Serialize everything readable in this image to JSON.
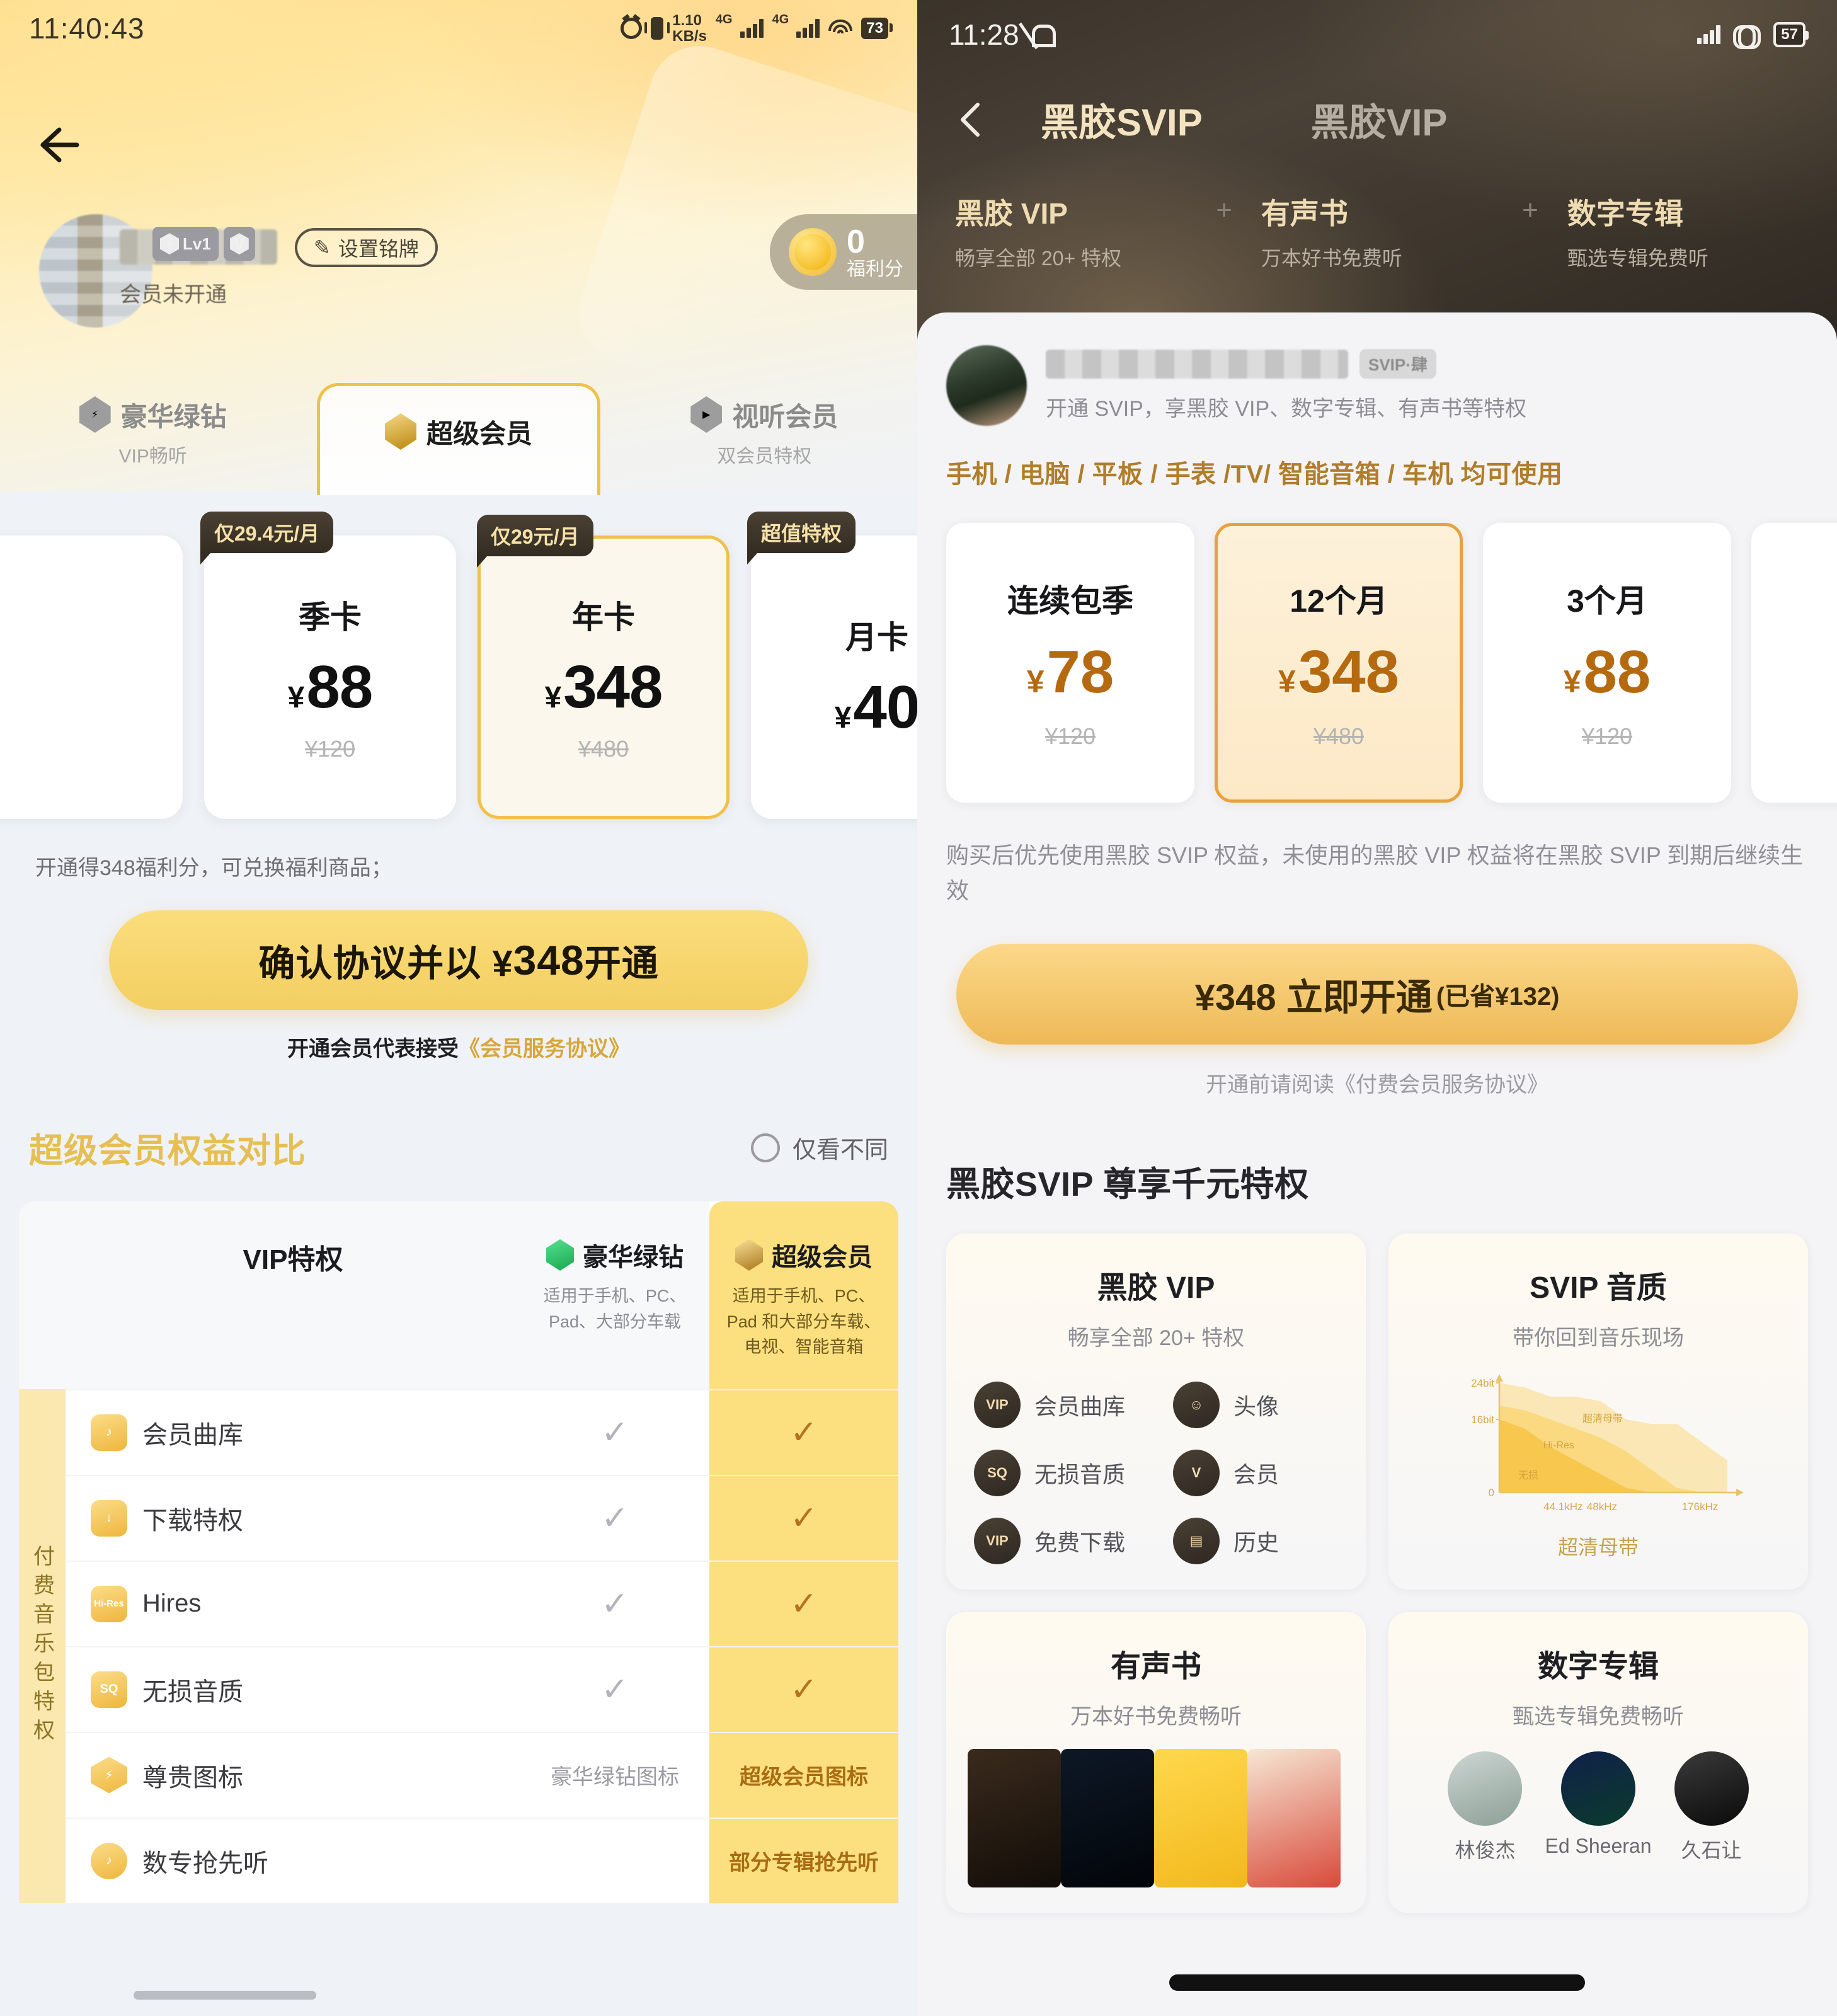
{
  "left": {
    "status": {
      "time": "11:40:43",
      "netspeed_value": "1.10",
      "netspeed_unit": "KB/s",
      "net_type_1": "4G",
      "net_type_2": "4G",
      "battery": "73"
    },
    "back_icon": "back-arrow-icon",
    "profile": {
      "level_badge": "Lv1",
      "set_plate_label": "设置铭牌",
      "membership_status": "会员未开通",
      "score_value": "0",
      "score_label": "福利分"
    },
    "tabs": [
      {
        "name": "豪华绿钻",
        "sub": "VIP畅听",
        "active": false
      },
      {
        "name": "超级会员",
        "sub": "",
        "active": true
      },
      {
        "name": "视听会员",
        "sub": "双会员特权",
        "active": false
      }
    ],
    "plans": [
      {
        "tag": "仅29.4元/月",
        "name": "季卡",
        "currency": "¥",
        "price": "88",
        "old": "¥120",
        "selected": false
      },
      {
        "tag": "仅29元/月",
        "name": "年卡",
        "currency": "¥",
        "price": "348",
        "old": "¥480",
        "selected": true
      },
      {
        "tag": "超值特权",
        "name": "月卡",
        "currency": "¥",
        "price": "40",
        "old": "",
        "selected": false
      }
    ],
    "benefit_note": "开通得348福利分，可兑换福利商品；",
    "cta": {
      "prefix": "确认协议并以 ¥",
      "amount": "348",
      "suffix": " 开通"
    },
    "agreement": {
      "text": "开通会员代表接受",
      "link": "《会员服务协议》"
    },
    "compare": {
      "title": "超级会员权益对比",
      "filter_label": "仅看不同",
      "side_label": "付费音乐包特权",
      "col_feature": "VIP特权",
      "col_green": {
        "brand": "豪华绿钻",
        "sub": "适用于手机、PC、Pad、大部分车载"
      },
      "col_super": {
        "brand": "超级会员",
        "sub": "适用于手机、PC、Pad 和大部分车载、电视、智能音箱"
      },
      "rows": [
        {
          "icon": "music-library-icon",
          "icon_text": "♪",
          "label": "会员曲库",
          "green": "✓",
          "super": "✓",
          "green_type": "check",
          "super_type": "check"
        },
        {
          "icon": "download-icon",
          "icon_text": "↓",
          "label": "下载特权",
          "green": "✓",
          "super": "✓",
          "green_type": "check",
          "super_type": "check"
        },
        {
          "icon": "hires-icon",
          "icon_text": "Hi-Res",
          "label": "Hires",
          "green": "✓",
          "super": "✓",
          "green_type": "check",
          "super_type": "check"
        },
        {
          "icon": "sq-icon",
          "icon_text": "SQ",
          "label": "无损音质",
          "green": "✓",
          "super": "✓",
          "green_type": "check",
          "super_type": "check"
        },
        {
          "icon": "vip-emblem-icon",
          "icon_text": "⚡",
          "label": "尊贵图标",
          "green": "豪华绿钻图标",
          "super": "超级会员图标",
          "green_type": "text",
          "super_type": "text"
        },
        {
          "icon": "album-preorder-icon",
          "icon_text": "♪",
          "label": "数专抢先听",
          "green": "",
          "super": "部分专辑抢先听",
          "green_type": "text",
          "super_type": "text"
        }
      ]
    }
  },
  "right": {
    "status": {
      "time": "11:28",
      "battery": "57"
    },
    "nav": {
      "back_icon": "back-chevron-icon",
      "tab_active": "黑胶SVIP",
      "tab_inactive": "黑胶VIP"
    },
    "hero_feats": [
      {
        "title": "黑胶 VIP",
        "sub": "畅享全部 20+ 特权"
      },
      {
        "title": "有声书",
        "sub": "万本好书免费听"
      },
      {
        "title": "数字专辑",
        "sub": "甄选专辑免费听"
      }
    ],
    "user": {
      "badge": "SVIP·肆",
      "desc": "开通 SVIP，享黑胶 VIP、数字专辑、有声书等特权"
    },
    "devices": "手机 / 电脑 / 平板 / 手表 /TV/ 智能音箱 / 车机 均可使用",
    "plans": [
      {
        "name": "连续包季",
        "currency": "¥",
        "price": "78",
        "old": "¥120",
        "selected": false
      },
      {
        "name": "12个月",
        "currency": "¥",
        "price": "348",
        "old": "¥480",
        "selected": true
      },
      {
        "name": "3个月",
        "currency": "¥",
        "price": "88",
        "old": "¥120",
        "selected": false
      }
    ],
    "note": "购买后优先使用黑胶 SVIP 权益，未使用的黑胶 VIP 权益将在黑胶 SVIP 到期后继续生效",
    "cta": {
      "main": "¥348 立即开通",
      "saved": "(已省¥132)"
    },
    "agreement": "开通前请阅读《付费会员服务协议》",
    "section_title": "黑胶SVIP 尊享千元特权",
    "cards": [
      {
        "title": "黑胶 VIP",
        "sub": "畅享全部 20+ 特权",
        "feats": [
          {
            "icon": "vip-library-icon",
            "glyph": "VIP",
            "label": "会员曲库"
          },
          {
            "icon": "avatar-frame-icon",
            "glyph": "☺",
            "label": "头像"
          },
          {
            "icon": "sq-quality-icon",
            "glyph": "SQ",
            "label": "无损音质"
          },
          {
            "icon": "member-emblem-icon",
            "glyph": "V",
            "label": "会员"
          },
          {
            "icon": "vip-download-icon",
            "glyph": "VIP",
            "label": "免费下载"
          },
          {
            "icon": "history-icon",
            "glyph": "🗓",
            "label": "历史"
          }
        ]
      },
      {
        "title": "SVIP 音质",
        "sub": "带你回到音乐现场",
        "chart_caption": "超清母带"
      },
      {
        "title": "有声书",
        "sub": "万本好书免费畅听"
      },
      {
        "title": "数字专辑",
        "sub": "甄选专辑免费畅听",
        "artists": [
          "林俊杰",
          "Ed Sheeran",
          "久石让"
        ]
      }
    ]
  },
  "chart_data": {
    "type": "area",
    "title": "超清母带",
    "xlabel": "",
    "ylabel": "",
    "x_ticks": [
      "44.1kHz",
      "48kHz",
      "176kHz"
    ],
    "y_ticks": [
      "0",
      "16bit",
      "24bit"
    ],
    "ylim": [
      0,
      24
    ],
    "series": [
      {
        "name": "无损",
        "values": [
          16,
          14,
          10,
          7,
          4,
          1,
          0,
          0,
          0,
          0
        ]
      },
      {
        "name": "Hi-Res",
        "values": [
          19,
          18,
          16,
          14,
          12,
          9,
          5,
          1,
          0,
          0
        ]
      },
      {
        "name": "超清母带",
        "values": [
          24,
          23,
          21,
          21,
          20,
          16,
          15,
          15,
          11,
          7
        ]
      }
    ],
    "legend_position": "inline",
    "grid": false
  },
  "colors": {
    "gold": "#f0c14b",
    "gold_dark": "#b56a10",
    "brand_brown": "#342c22",
    "bg": "#eff2f6"
  }
}
